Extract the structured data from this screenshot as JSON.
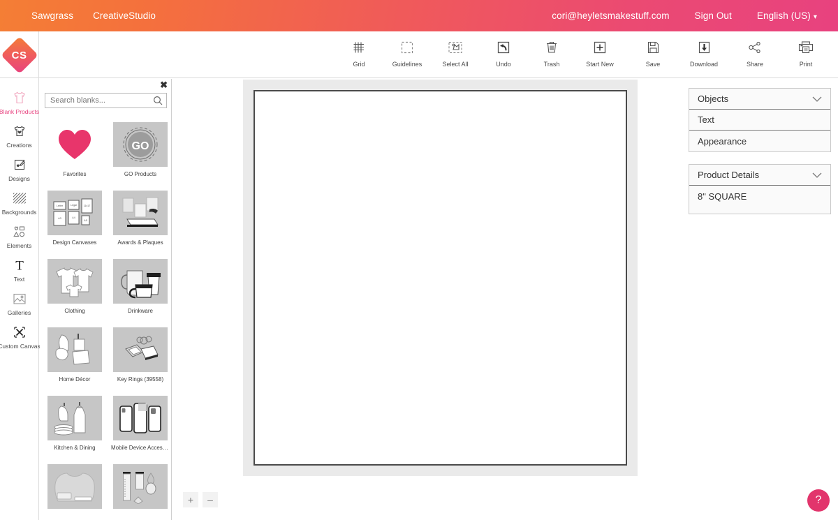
{
  "topbar": {
    "brand": "Sawgrass",
    "app": "CreativeStudio",
    "account_email": "cori@heyletsmakestuff.com",
    "sign_out": "Sign Out",
    "language": "English (US)",
    "language_chevron": "∨",
    "gradient_from": "#f47e35",
    "gradient_to": "#e8427f"
  },
  "logo": {
    "text": "CS"
  },
  "toolbar": {
    "center_tools": [
      {
        "label": "Grid",
        "icon": "grid-icon"
      },
      {
        "label": "Guidelines",
        "icon": "guidelines-icon"
      },
      {
        "label": "Select All",
        "icon": "select-all-icon"
      },
      {
        "label": "Undo",
        "icon": "undo-icon"
      },
      {
        "label": "Trash",
        "icon": "trash-icon"
      },
      {
        "label": "Start New",
        "icon": "plus-icon"
      }
    ],
    "right_tools": [
      {
        "label": "Save",
        "icon": "floppy-disk-icon"
      },
      {
        "label": "Download",
        "icon": "download-icon"
      },
      {
        "label": "Share",
        "icon": "share-icon"
      },
      {
        "label": "Print",
        "icon": "printer-icon"
      }
    ]
  },
  "sidebar": {
    "items": [
      {
        "label": "Blank Products",
        "icon": "tshirt-outline-icon",
        "active": true
      },
      {
        "label": "Creations",
        "icon": "tshirt-heart-icon",
        "active": false
      },
      {
        "label": "Designs",
        "icon": "design-pen-icon",
        "active": false
      },
      {
        "label": "Backgrounds",
        "icon": "hatch-pattern-icon",
        "active": false
      },
      {
        "label": "Elements",
        "icon": "shapes-icon",
        "active": false
      },
      {
        "label": "Text",
        "icon": "text-t-icon",
        "active": false
      },
      {
        "label": "Galleries",
        "icon": "photo-icon",
        "active": false
      },
      {
        "label": "Custom Canvas",
        "icon": "resize-arrows-icon",
        "active": false
      }
    ],
    "active_color": "#e8427f"
  },
  "blanks_panel": {
    "close_label": "✖",
    "search_placeholder": "Search blanks...",
    "search_value": "",
    "categories": [
      {
        "label": "Favorites",
        "icon": "heart-icon",
        "thumb": "plain"
      },
      {
        "label": "GO Products",
        "icon": "go-badge-icon",
        "thumb": "gray"
      },
      {
        "label": "Design Canvases",
        "icon": "canvases-icon",
        "thumb": "gray"
      },
      {
        "label": "Awards & Plaques",
        "icon": "awards-icon",
        "thumb": "gray"
      },
      {
        "label": "Clothing",
        "icon": "clothing-icon",
        "thumb": "gray"
      },
      {
        "label": "Drinkware",
        "icon": "drinkware-icon",
        "thumb": "gray"
      },
      {
        "label": "Home Décor",
        "icon": "home-decor-icon",
        "thumb": "gray"
      },
      {
        "label": "Key Rings (39558)",
        "icon": "key-rings-icon",
        "thumb": "gray"
      },
      {
        "label": "Kitchen & Dining",
        "icon": "kitchen-icon",
        "thumb": "gray"
      },
      {
        "label": "Mobile Device Accesso...",
        "icon": "phone-cases-icon",
        "thumb": "gray"
      },
      {
        "label": "",
        "icon": "apparel-icon",
        "thumb": "gray"
      },
      {
        "label": "",
        "icon": "jewelry-icon",
        "thumb": "gray"
      }
    ]
  },
  "workspace": {
    "zoom_in": "+",
    "zoom_out": "–"
  },
  "right_panel": {
    "objects_group": {
      "header": "Objects",
      "rows": [
        "Text",
        "Appearance"
      ]
    },
    "product_details_group": {
      "header": "Product Details",
      "value": "8\" SQUARE"
    }
  },
  "help": {
    "label": "?",
    "color": "#e2356c"
  }
}
